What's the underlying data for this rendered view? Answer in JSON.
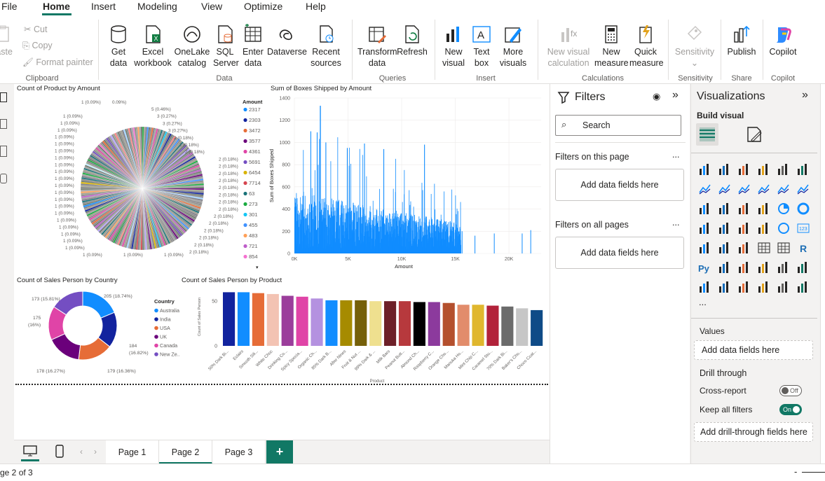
{
  "menu": {
    "items": [
      "File",
      "Home",
      "Insert",
      "Modeling",
      "View",
      "Optimize",
      "Help"
    ]
  },
  "ribbon": {
    "clipboard": {
      "paste": "Paste",
      "cut": "Cut",
      "copy": "Copy",
      "format_painter": "Format painter",
      "group": "Clipboard"
    },
    "data": {
      "get_data": "Get data",
      "excel": "Excel workbook",
      "onelake": "OneLake catalog",
      "sql": "SQL Server",
      "enter": "Enter data",
      "dataverse": "Dataverse",
      "recent": "Recent sources",
      "group": "Data"
    },
    "queries": {
      "transform": "Transform data",
      "refresh": "Refresh",
      "group": "Queries"
    },
    "insert": {
      "new_visual": "New visual",
      "text_box": "Text box",
      "more_visuals": "More visuals",
      "group": "Insert"
    },
    "calculations": {
      "new_visual_calc": "New visual calculation",
      "new_measure": "New measure",
      "quick_measure": "Quick measure",
      "group": "Calculations"
    },
    "sensitivity": {
      "label": "Sensitivity",
      "group": "Sensitivity"
    },
    "share": {
      "publish": "Publish",
      "group": "Share"
    },
    "copilot": {
      "label": "Copilot",
      "group": "Copilot"
    }
  },
  "colors": {
    "accent": "#117865",
    "canvas_bg": "#ffffff",
    "bar_blue": "#118dff"
  },
  "visuals": {
    "pie": {
      "title": "Count of Product by Amount",
      "legend_title": "Amount",
      "legend": [
        {
          "label": "2317",
          "color": "#118dff"
        },
        {
          "label": "2303",
          "color": "#12239e"
        },
        {
          "label": "3472",
          "color": "#e66c37"
        },
        {
          "label": "3577",
          "color": "#6b007b"
        },
        {
          "label": "4361",
          "color": "#e044a7"
        },
        {
          "label": "5691",
          "color": "#744ec2"
        },
        {
          "label": "6454",
          "color": "#d9b300"
        },
        {
          "label": "7714",
          "color": "#d64550"
        },
        {
          "label": "63",
          "color": "#197278"
        },
        {
          "label": "273",
          "color": "#1aab40"
        },
        {
          "label": "301",
          "color": "#15c6f4"
        },
        {
          "label": "455",
          "color": "#4092ff"
        },
        {
          "label": "483",
          "color": "#ffa058"
        },
        {
          "label": "721",
          "color": "#be5dc9"
        },
        {
          "label": "854",
          "color": "#f472d0"
        }
      ],
      "right_labels": [
        "5 (0.46%)",
        "3 (0.27%)",
        "3 (0.27%)",
        "3 (0.27%)",
        "2 (0.18%)",
        "2 (0.18%)",
        "2 (0.18%)",
        "2 (0.18%)",
        "2 (0.18%)",
        "2 (0.18%)",
        "2 (0.18%)",
        "2 (0.18%)",
        "2 (0.18%)",
        "2 (0.18%)",
        "2 (0.18%)",
        "2 (0.18%)",
        "2 (0.18%)",
        "2 (0.18%)",
        "2 (0.18%)",
        "2 (0.18%)",
        "2 (0.18%)"
      ],
      "left_labels": [
        "1 (0.09%)",
        "1 (0.09%)",
        "1 (0.09%)",
        "1 (0.09%)",
        "1 (0.09%)",
        "1 (0.09%)",
        "1 (0.09%)",
        "1 (0.09%)",
        "1 (0.09%)",
        "1 (0.09%)",
        "1 (0.09%)",
        "1 (0.09%)",
        "1 (0.09%)",
        "1 (0.09%)",
        "1 (0.09%)",
        "1 (0.09%)",
        "1 (0.09%)",
        "1 (0.09%)",
        "1 (0.09%)",
        "1 (0.09%)"
      ],
      "bottom_labels": [
        "1 (0.09%)",
        "1 (0.09%)",
        "1 (0.09%)"
      ],
      "top_labels": [
        "1 (0.09%)",
        "0.09%)"
      ]
    },
    "bar_amount": {
      "title": "Sum of Boxes Shipped by Amount",
      "ylabel": "Sum of Boxes Shipped",
      "xlabel": "Amount",
      "yticks": [
        "0",
        "200",
        "400",
        "600",
        "800",
        "1000",
        "1200",
        "1400"
      ],
      "xticks": [
        "0K",
        "5K",
        "10K",
        "15K",
        "20K"
      ]
    },
    "donut": {
      "title": "Count of Sales Person by Country",
      "legend_title": "Country",
      "legend": [
        {
          "label": "Australia",
          "color": "#118dff"
        },
        {
          "label": "India",
          "color": "#12239e"
        },
        {
          "label": "USA",
          "color": "#e66c37"
        },
        {
          "label": "UK",
          "color": "#6b007b"
        },
        {
          "label": "Canada",
          "color": "#e044a7"
        },
        {
          "label": "New Ze...",
          "color": "#744ec2"
        }
      ],
      "labels": [
        "205 (18.74%)",
        "184 (16.82%)",
        "179 (16.36%)",
        "178 (16.27%)",
        "175 (16%)",
        "173 (15.81%)"
      ]
    },
    "bar_product": {
      "title": "Count of Sales Person by Product",
      "ylabel": "Count of Sales Person",
      "xlabel": "Product",
      "yticks": [
        "0",
        "50"
      ],
      "categories": [
        "50% Dark Bi...",
        "Eclairs",
        "Smooth Sili...",
        "White Choc",
        "Drinking Co...",
        "Spicy Specia...",
        "Organic Ch...",
        "85% Dark B...",
        "After Nines",
        "Fruit & Nut ...",
        "99% Dark & ...",
        "Milk Bars",
        "Peanut Butt...",
        "Almond Ch...",
        "Raspberry C...",
        "Orange Cho...",
        "Manuka Ho...",
        "Mint Chip C...",
        "Caramel Stu...",
        "70% Dark Bi...",
        "Baker's Cho...",
        "Choco Coat..."
      ]
    }
  },
  "chart_data": [
    {
      "type": "bar",
      "title": "Count of Sales Person by Product",
      "xlabel": "Product",
      "ylabel": "Count of Sales Person",
      "categories": [
        "50% Dark Bi...",
        "Eclairs",
        "Smooth Sili...",
        "White Choc",
        "Drinking Co...",
        "Spicy Specia...",
        "Organic Ch...",
        "85% Dark B...",
        "After Nines",
        "Fruit & Nut ...",
        "99% Dark & ...",
        "Milk Bars",
        "Peanut Butt...",
        "Almond Ch...",
        "Raspberry C...",
        "Orange Cho...",
        "Manuka Ho...",
        "Mint Chip C...",
        "Caramel Stu...",
        "70% Dark Bi...",
        "Baker's Cho...",
        "Choco Coat..."
      ],
      "values": [
        60,
        60,
        59,
        58,
        56,
        55,
        53,
        51,
        51,
        51,
        50,
        50,
        50,
        49,
        49,
        48,
        46,
        46,
        45,
        44,
        42,
        40
      ],
      "colors": [
        "#12239e",
        "#118dff",
        "#e66c37",
        "#f3c3b3",
        "#9b3d9b",
        "#e044a7",
        "#b491e0",
        "#118dff",
        "#a68b00",
        "#75600a",
        "#efe08f",
        "#6d2028",
        "#b7393d",
        "#000000",
        "#8c3a9d",
        "#b4502e",
        "#e28c6b",
        "#e0b72e",
        "#b2223a",
        "#6b6b6b",
        "#c6c6c6",
        "#0f4b87"
      ],
      "ylim": [
        0,
        65
      ],
      "grid": false
    },
    {
      "type": "pie",
      "title": "Count of Sales Person by Country",
      "categories": [
        "Australia",
        "India",
        "USA",
        "UK",
        "Canada",
        "New Ze..."
      ],
      "values": [
        205,
        184,
        179,
        178,
        175,
        173
      ]
    },
    {
      "type": "bar",
      "title": "Sum of Boxes Shipped by Amount",
      "xlabel": "Amount",
      "ylabel": "Sum of Boxes Shipped",
      "xlim": [
        0,
        23000
      ],
      "ylim": [
        0,
        1400
      ],
      "grid": true
    }
  ],
  "filters": {
    "title": "Filters",
    "search": "Search",
    "on_page": "Filters on this page",
    "on_all": "Filters on all pages",
    "add": "Add data fields here",
    "more": "..."
  },
  "viz_pane": {
    "title": "Visualizations",
    "build": "Build visual",
    "values": "Values",
    "add_values": "Add data fields here",
    "drill": "Drill through",
    "cross": "Cross-report",
    "off": "Off",
    "keep": "Keep all filters",
    "on": "On",
    "add_drill": "Add drill-through fields here",
    "more": "..."
  },
  "pages": {
    "tabs": [
      "Page 1",
      "Page 2",
      "Page 3"
    ],
    "active": "Page 2",
    "add": "+"
  },
  "status": {
    "page": "ge 2 of 3",
    "zoom_minus": "-"
  }
}
